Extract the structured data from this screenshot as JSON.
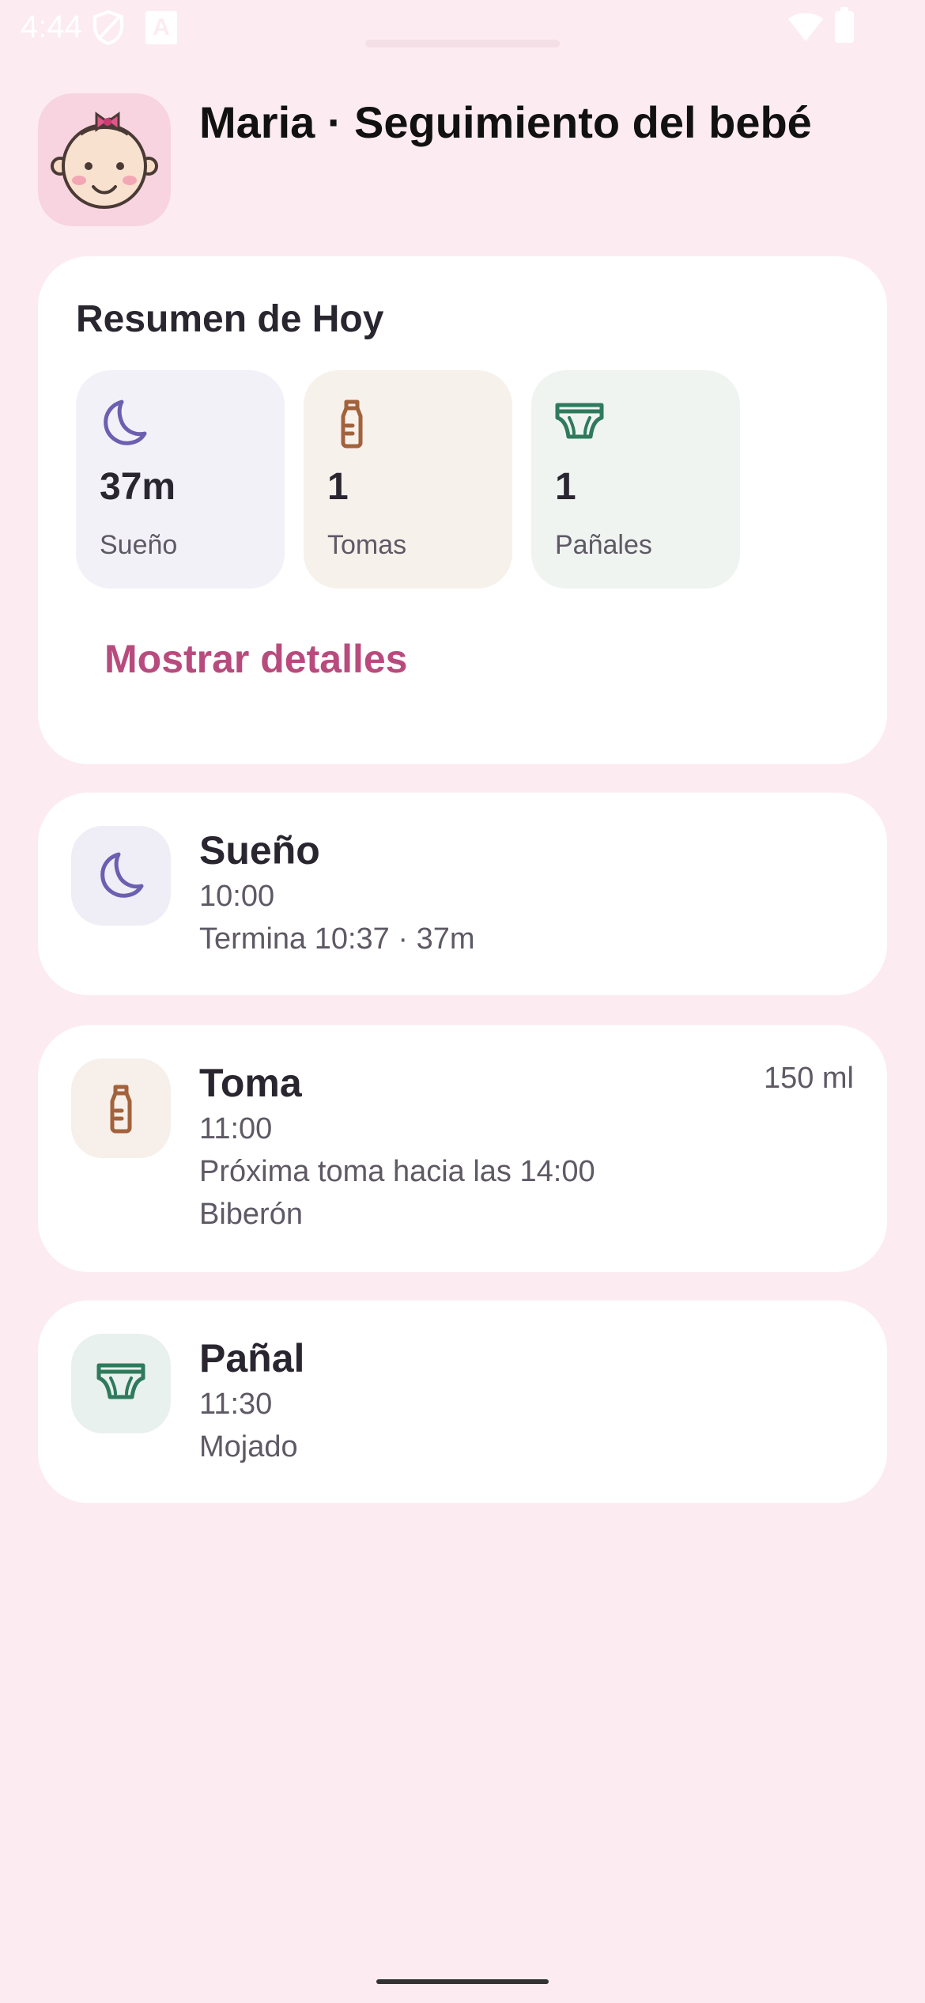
{
  "status_bar": {
    "time": "4:44",
    "a_glyph": "A"
  },
  "header": {
    "title": "Maria · Seguimiento del bebé",
    "avatar_icon": "baby-face-icon"
  },
  "summary": {
    "title": "Resumen de Hoy",
    "tiles": [
      {
        "icon": "moon-icon",
        "value": "37m",
        "label": "Sueño",
        "color": "#6b5fb0"
      },
      {
        "icon": "bottle-icon",
        "value": "1",
        "label": "Tomas",
        "color": "#a2623c"
      },
      {
        "icon": "diaper-icon",
        "value": "1",
        "label": "Pañales",
        "color": "#2f7a5c"
      }
    ],
    "details_button": "Mostrar detalles"
  },
  "events": [
    {
      "icon": "moon-icon",
      "title": "Sueño",
      "time": "10:00",
      "lines": [
        "Termina 10:37 · 37m"
      ]
    },
    {
      "icon": "bottle-icon",
      "title": "Toma",
      "time": "11:00",
      "amount": "150 ml",
      "lines": [
        "Próxima toma hacia las 14:00",
        "Biberón"
      ]
    },
    {
      "icon": "diaper-icon",
      "title": "Pañal",
      "time": "11:30",
      "lines": [
        "Mojado"
      ]
    }
  ],
  "colors": {
    "background": "#fcecf1",
    "accent": "#b84b7d",
    "card": "#ffffff"
  }
}
